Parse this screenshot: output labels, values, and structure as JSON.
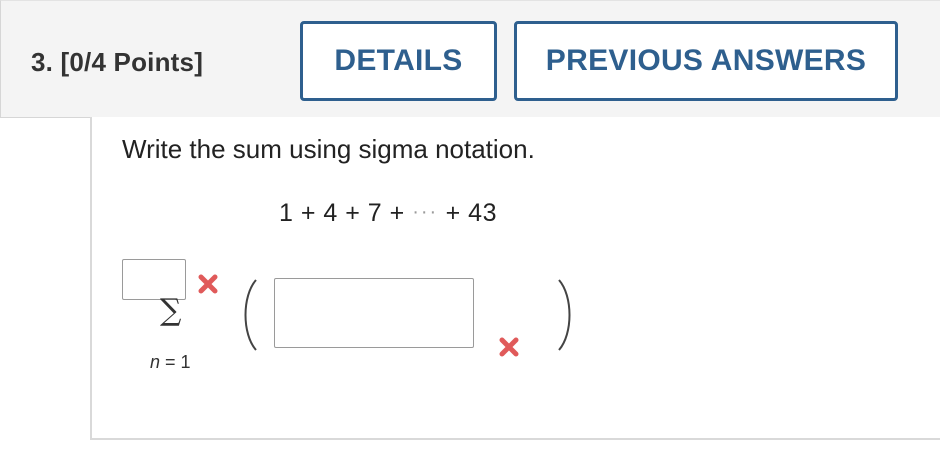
{
  "question": {
    "number_label": "3.",
    "points_label": "[0/4 Points]"
  },
  "header": {
    "details_label": "DETAILS",
    "previous_answers_label": "PREVIOUS ANSWERS",
    "button_color": "#2e5f8e"
  },
  "problem": {
    "prompt": "Write the sum using sigma notation.",
    "sum_expression": {
      "part_before": "1 + 4 + 7 + ",
      "ellipsis": "···",
      "part_after": " + 43"
    },
    "sigma_symbol": "∑",
    "lower_limit": {
      "variable": "n",
      "rest": " = 1"
    },
    "upper_limit_input": {
      "value": "",
      "status": "incorrect"
    },
    "term_input": {
      "value": "",
      "status": "incorrect"
    },
    "incorrect_icon": "x-mark-icon",
    "incorrect_color": "#e05a5a"
  }
}
